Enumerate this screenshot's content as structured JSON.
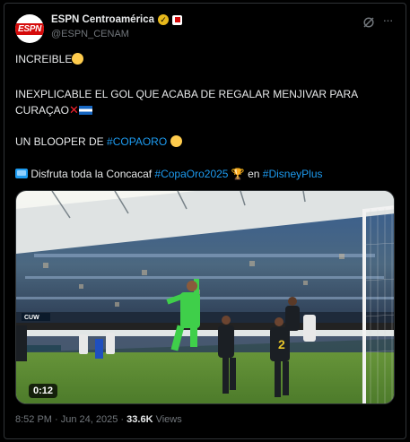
{
  "author": {
    "name": "ESPN Centroamérica",
    "handle": "@ESPN_CENAM",
    "avatar_text": "ESPN"
  },
  "tweet": {
    "line1": "INCREIBLE",
    "line2": "INEXPLICABLE EL GOL QUE ACABA DE REGALAR MENJIVAR PARA",
    "line3": "CURAÇAO",
    "line4_prefix": "UN BLOOPER DE ",
    "line4_hashtag": "#COPAORO",
    "line5_prefix": "Disfruta toda la Concacaf ",
    "line5_hashtag1": "#CopaOro2025",
    "line5_middle": " en ",
    "line5_hashtag2": "#DisneyPlus"
  },
  "video": {
    "duration": "0:12",
    "score_overlay": "CUW"
  },
  "meta": {
    "time": "8:52 PM",
    "separator": " · ",
    "date": "Jun 24, 2025",
    "views_count": "33.6K",
    "views_label": " Views"
  },
  "icons": {
    "verified": "verified-badge-icon",
    "grok": "grok-icon",
    "more": "more-icon"
  },
  "colors": {
    "link": "#1d9bf0",
    "verified": "#e8b91c",
    "espn_red": "#d50a0a"
  }
}
